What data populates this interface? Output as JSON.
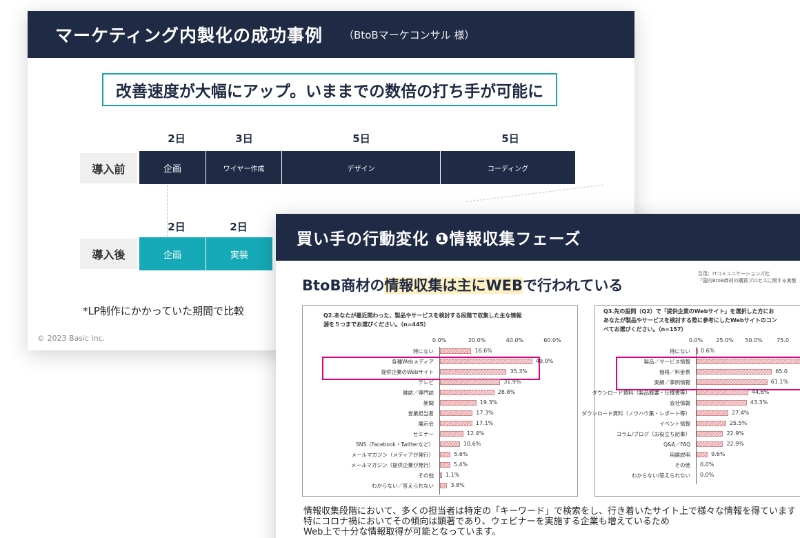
{
  "slide1": {
    "title": "マーケティング内製化の成功事例",
    "subtitle": "（BtoBマーケコンサル 様）",
    "banner": "改善速度が大幅にアップ。いままでの数倍の打ち手が可能に",
    "before_label": "導入前",
    "after_label": "導入後",
    "before_durations": [
      "2日",
      "3日",
      "5日",
      "5日"
    ],
    "before_steps": [
      "企画",
      "ワイヤー作成",
      "デザイン",
      "コーディング"
    ],
    "after_durations": [
      "2日",
      "2日"
    ],
    "after_steps": [
      "企画",
      "実装"
    ],
    "note": "*LP制作にかかっていた期間で比較",
    "copyright": "© 2023 Basic inc."
  },
  "slide2": {
    "title": "買い手の行動変化 ❶情報収集フェーズ",
    "headline_pre": "BtoB商材の",
    "headline_hl1": "情報収集は主に",
    "headline_hl2": "WEB",
    "headline_post": "で行われている",
    "citation_1": "引用：ITコミュニケーションズ社",
    "citation_2": "「国内BtoB商材の購買プロセスに関する実態",
    "footer_1": "情報収集段階において、多くの担当者は特定の「キーワード」で検索をし、行き着いたサイト上で様々な情報を得ています",
    "footer_2": "特にコロナ禍においてその傾向は顕著であり、ウェビナーを実施する企業も増えているため",
    "footer_3": "Web上で十分な情報取得が可能となっています。"
  },
  "chart_data": [
    {
      "type": "bar",
      "orientation": "horizontal",
      "title": "Q2.あなたが最近関わった、製品やサービスを検討する段階で収集した主な情報源を５つまでお選びください。（n=445）",
      "title_lines": [
        "Q2.あなたが最近関わった、製品やサービスを検討する段階で収集した主な情報",
        "源を５つまでお選びください。（n=445）"
      ],
      "xlim": [
        0,
        60
      ],
      "ticks": [
        "0.0%",
        "20.0%",
        "40.0%",
        "60.0%"
      ],
      "categories": [
        "特にない",
        "各種Webメディア",
        "提供企業のWebサイト",
        "テレビ",
        "雑誌／専門誌",
        "新聞",
        "営業担当者",
        "展示会",
        "セミナー",
        "SNS（Facebook・Twitterなど）",
        "メールマガジン（メディアが発行）",
        "メールマガジン（提供企業が発行）",
        "その他",
        "わからない／答えられない"
      ],
      "values": [
        16.6,
        49.0,
        35.3,
        31.9,
        28.8,
        19.3,
        17.3,
        17.1,
        12.4,
        10.6,
        5.6,
        5.4,
        1.1,
        3.8
      ],
      "labels": [
        "16.6%",
        "49.0%",
        "35.3%",
        "31.9%",
        "28.8%",
        "19.3%",
        "17.3%",
        "17.1%",
        "12.4%",
        "10.6%",
        "5.6%",
        "5.4%",
        "1.1%",
        "3.8%"
      ],
      "highlighted": [
        1,
        2
      ]
    },
    {
      "type": "bar",
      "orientation": "horizontal",
      "title_lines": [
        "Q3.先の設問（Q2）で「提供企業のWebサイト」を選択した方にお",
        "あなたが製品やサービスを検討する際に参考にしたWebサイトのコン",
        "べてお選びください。（n=157）"
      ],
      "xlim": [
        0,
        75
      ],
      "ticks": [
        "0.0%",
        "25.0%",
        "50.0%",
        "75.0"
      ],
      "categories": [
        "特にない",
        "製品／サービス情報",
        "価格／料金表",
        "実績／事例情報",
        "ダウンロード資料（製品概要・仕様書等）",
        "会社情報",
        "ダウンロード資料（ノウハウ集・レポート等）",
        "イベント情報",
        "コラム/ブログ（お役立ち記事）",
        "Q&A／FAQ",
        "用語説明",
        "その他",
        "わからない/答えられない"
      ],
      "values": [
        0.6,
        null,
        65.0,
        61.1,
        44.6,
        43.3,
        27.4,
        25.5,
        22.9,
        22.9,
        9.6,
        0.0,
        0.0
      ],
      "labels": [
        "0.6%",
        "",
        "65.0",
        "61.1%",
        "44.6%",
        "43.3%",
        "27.4%",
        "25.5%",
        "22.9%",
        "22.9%",
        "9.6%",
        "0.0%",
        "0.0%"
      ],
      "highlighted": [
        1,
        2,
        3
      ]
    }
  ]
}
